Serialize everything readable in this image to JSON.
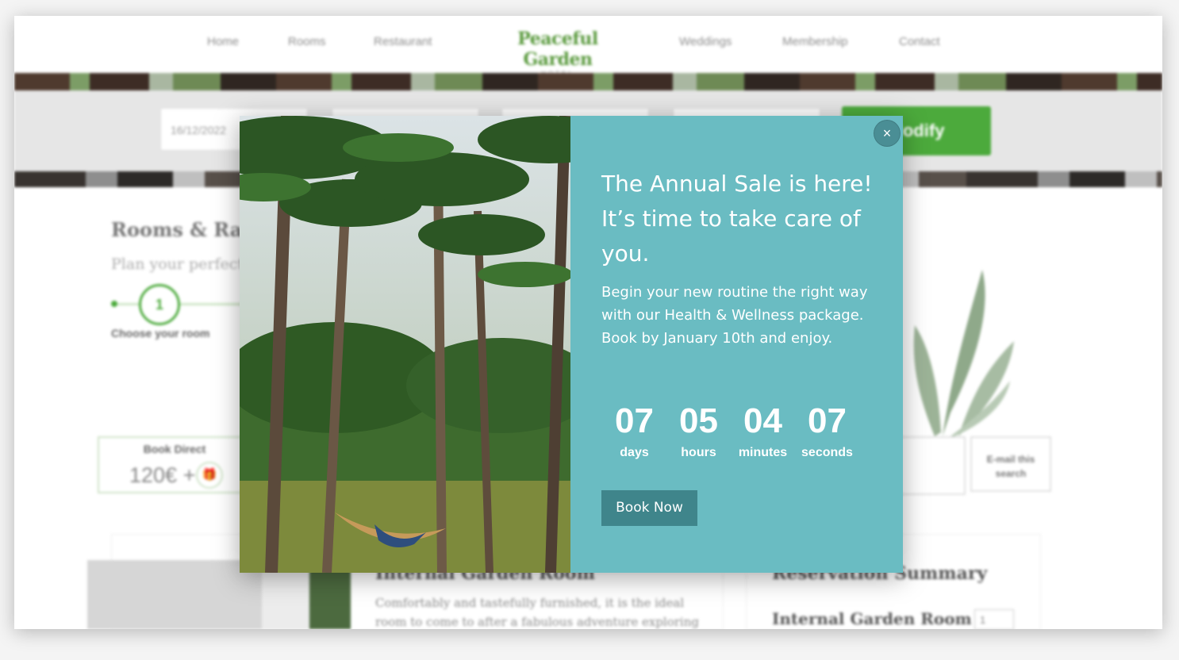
{
  "nav": {
    "left_items": [
      "Home",
      "Rooms",
      "Restaurant"
    ],
    "right_items": [
      "Weddings",
      "Membership",
      "Contact"
    ],
    "logo_name": "Peaceful Garden",
    "logo_sub": "HOTEL"
  },
  "search": {
    "date_value": "16/12/2022",
    "modify_label": "Modify"
  },
  "rooms": {
    "title": "Rooms & Rates",
    "subtitle": "Plan your perfect stay",
    "step_number": "1",
    "step_label": "Choose your room"
  },
  "book_direct": {
    "title": "Book Direct",
    "price": "120€ +"
  },
  "email_search_label": "E-mail this search",
  "room_card": {
    "title": "Internal Garden Room",
    "desc_line1": "Comfortably and tastefully furnished, it is the ideal",
    "desc_line2": "room to come to after a fabulous adventure exploring"
  },
  "summary": {
    "title": "Reservation Summary",
    "room": "Internal Garden Room",
    "qty": "1"
  },
  "modal": {
    "close_label": "×",
    "headline": "The Annual Sale is here! It’s time to take care of you.",
    "body": "Begin your new routine the right way with our Health & Wellness package. Book by January 10th and enjoy.",
    "countdown": [
      {
        "value": "07",
        "label": "days"
      },
      {
        "value": "05",
        "label": "hours"
      },
      {
        "value": "04",
        "label": "minutes"
      },
      {
        "value": "07",
        "label": "seconds"
      }
    ],
    "cta": "Book Now",
    "panel_color": "#6abcc2"
  }
}
